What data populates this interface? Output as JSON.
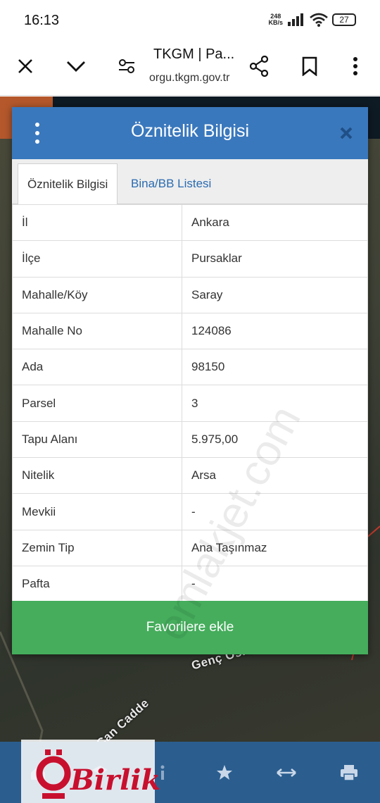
{
  "status_bar": {
    "time": "16:13",
    "net_speed_value": "248",
    "net_speed_unit": "KB/s",
    "battery": "27"
  },
  "browser": {
    "title": "TKGM | Pa...",
    "url": "orgu.tkgm.gov.tr",
    "icons": [
      "close-icon",
      "chevron-down-icon",
      "site-settings-icon",
      "share-icon",
      "bookmark-icon",
      "more-vert-icon"
    ]
  },
  "dialog": {
    "title": "Öznitelik Bilgisi",
    "tabs": [
      {
        "label": "Öznitelik Bilgisi",
        "active": true
      },
      {
        "label": "Bina/BB Listesi",
        "active": false
      }
    ],
    "rows": [
      {
        "key": "İl",
        "value": "Ankara"
      },
      {
        "key": "İlçe",
        "value": "Pursaklar"
      },
      {
        "key": "Mahalle/Köy",
        "value": "Saray"
      },
      {
        "key": "Mahalle No",
        "value": "124086"
      },
      {
        "key": "Ada",
        "value": "98150"
      },
      {
        "key": "Parsel",
        "value": "3"
      },
      {
        "key": "Tapu Alanı",
        "value": "5.975,00"
      },
      {
        "key": "Nitelik",
        "value": "Arsa"
      },
      {
        "key": "Mevkii",
        "value": "-"
      },
      {
        "key": "Zemin Tip",
        "value": "Ana Taşınmaz"
      },
      {
        "key": "Pafta",
        "value": "-"
      }
    ],
    "favorite_button": "Favorilere ekle"
  },
  "map": {
    "road_labels": [
      "Genç Osman Ca",
      "Can Cadde"
    ]
  },
  "watermark": "emlakjet.com",
  "logo": {
    "text": "Birlik"
  },
  "colors": {
    "header_blue": "#3a78bd",
    "button_green": "#45ad5c",
    "nav_blue": "#2b5e8f",
    "tab_link": "#2a6bb0",
    "logo_red": "#c8102e"
  }
}
